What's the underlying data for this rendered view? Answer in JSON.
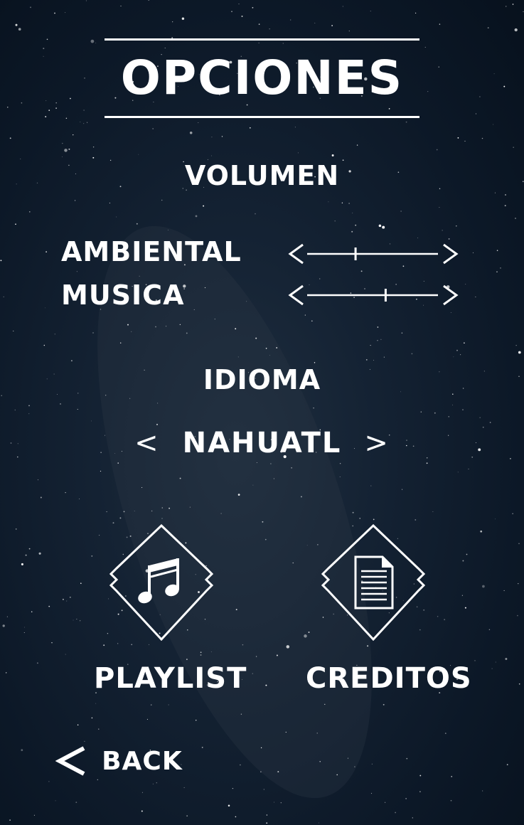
{
  "title": "OPCIONES",
  "volume": {
    "heading": "VOLUMEN",
    "sliders": [
      {
        "label": "AMBIENTAL",
        "level": 0.37,
        "left_arrow": "<",
        "right_arrow": ">"
      },
      {
        "label": "MUSICA",
        "level": 0.6,
        "left_arrow": "<",
        "right_arrow": ">"
      }
    ]
  },
  "language": {
    "heading": "IDIOMA",
    "value": "NAHUATL",
    "prev_arrow": "<",
    "next_arrow": ">"
  },
  "menu": {
    "playlist_label": "PLAYLIST",
    "playlist_icon": "music-note-icon",
    "credits_label": "CREDITOS",
    "credits_icon": "document-icon"
  },
  "back": {
    "label": "BACK",
    "icon": "chevron-left-icon"
  },
  "colors": {
    "text": "#ffffff",
    "sky_dark": "#0c1827",
    "sky_glow": "#1f2e3f"
  }
}
